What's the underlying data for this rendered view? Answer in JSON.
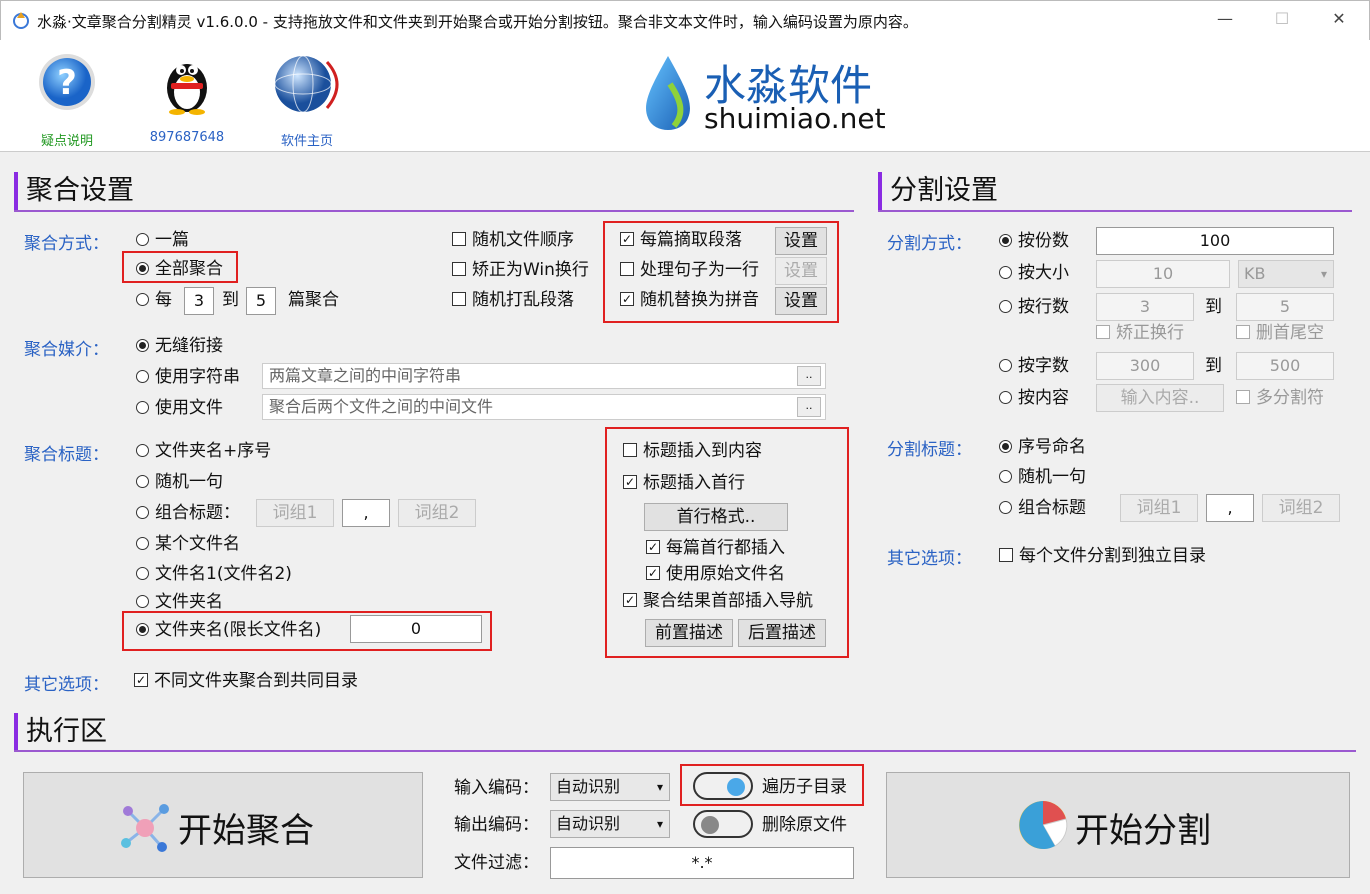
{
  "titlebar": {
    "title": "水淼·文章聚合分割精灵 v1.6.0.0 - 支持拖放文件和文件夹到开始聚合或开始分割按钮。聚合非文本文件时，输入编码设置为原内容。",
    "minimize": "—",
    "maximize": "☐",
    "close": "✕"
  },
  "header": {
    "help_label": "疑点说明",
    "qq_label": "897687648",
    "home_label": "软件主页",
    "logo_cn": "水淼软件",
    "logo_en": "shuimiao.net"
  },
  "merge": {
    "section_title": "聚合设置",
    "mode_label": "聚合方式：",
    "mode_one": "一篇",
    "mode_all": "全部聚合",
    "mode_each_prefix": "每",
    "mode_each_from": "3",
    "mode_each_to_word": "到",
    "mode_each_to": "5",
    "mode_each_suffix": "篇聚合",
    "random_order": "随机文件顺序",
    "fix_win_newline": "矫正为Win换行",
    "shuffle_paragraphs": "随机打乱段落",
    "extract_paragraph": "每篇摘取段落",
    "sentence_one_line": "处理句子为一行",
    "replace_pinyin": "随机替换为拼音",
    "settings_btn": "设置",
    "medium_label": "聚合媒介：",
    "medium_seamless": "无缝衔接",
    "medium_string": "使用字符串",
    "medium_string_placeholder": "两篇文章之间的中间字符串",
    "medium_file": "使用文件",
    "medium_file_placeholder": "聚合后两个文件之间的中间文件",
    "browse": "..",
    "title_label": "聚合标题：",
    "title_folder_seq": "文件夹名+序号",
    "title_random": "随机一句",
    "title_combo": "组合标题：",
    "word_group1": "词组1",
    "separator": ",",
    "word_group2": "词组2",
    "title_some_file": "某个文件名",
    "title_file1_file2": "文件名1(文件名2)",
    "title_folder": "文件夹名",
    "title_folder_limited": "文件夹名(限长文件名)",
    "title_limit_value": "0",
    "insert_title_content": "标题插入到内容",
    "insert_title_first": "标题插入首行",
    "first_line_format": "首行格式..",
    "each_first_insert": "每篇首行都插入",
    "use_original_name": "使用原始文件名",
    "insert_nav": "聚合结果首部插入导航",
    "pre_desc": "前置描述",
    "post_desc": "后置描述",
    "other_label": "其它选项：",
    "other_common_dir": "不同文件夹聚合到共同目录"
  },
  "split": {
    "section_title": "分割设置",
    "mode_label": "分割方式：",
    "by_count": "按份数",
    "count_value": "100",
    "by_size": "按大小",
    "size_value": "10",
    "size_unit": "KB",
    "by_lines": "按行数",
    "lines_from": "3",
    "to_word": "到",
    "lines_to": "5",
    "fix_newline": "矫正换行",
    "delete_tail_blank": "删首尾空",
    "by_chars": "按字数",
    "chars_from": "300",
    "chars_to": "500",
    "by_content": "按内容",
    "input_content": "输入内容..",
    "multi_separator": "多分割符",
    "title_label": "分割标题：",
    "title_seq": "序号命名",
    "title_random": "随机一句",
    "title_combo": "组合标题",
    "word_group1": "词组1",
    "separator": ",",
    "word_group2": "词组2",
    "other_label": "其它选项：",
    "other_own_dir": "每个文件分割到独立目录"
  },
  "exec": {
    "section_title": "执行区",
    "start_merge": "开始聚合",
    "input_encoding_label": "输入编码：",
    "input_encoding": "自动识别",
    "output_encoding_label": "输出编码：",
    "output_encoding": "自动识别",
    "filter_label": "文件过滤：",
    "filter_value": "*.*",
    "traverse_subdir": "遍历子目录",
    "delete_source": "删除原文件",
    "start_split": "开始分割",
    "colors": {
      "toggle_on": "#4aa8e8",
      "toggle_off": "#888888",
      "accent": "#8a2be2",
      "highlight": "#e02020"
    }
  }
}
